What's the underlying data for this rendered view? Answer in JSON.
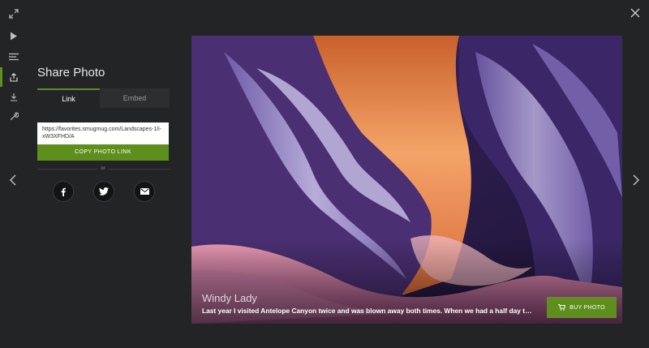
{
  "colors": {
    "accent": "#5e8f1c",
    "background": "#232425"
  },
  "toolbar": {
    "items": [
      {
        "name": "fullscreen",
        "icon": "expand-icon"
      },
      {
        "name": "slideshow",
        "icon": "play-icon"
      },
      {
        "name": "details",
        "icon": "menu-icon"
      },
      {
        "name": "share",
        "icon": "share-icon",
        "active": true
      },
      {
        "name": "download",
        "icon": "download-icon"
      },
      {
        "name": "tools",
        "icon": "wrench-icon"
      }
    ]
  },
  "share": {
    "title": "Share Photo",
    "tabs": [
      {
        "label": "Link",
        "active": true
      },
      {
        "label": "Embed",
        "active": false
      }
    ],
    "link_url": "https://favorites.smugmug.com/Landscapes-1/i-xW3XFHD/A",
    "copy_label": "COPY PHOTO LINK",
    "or_label": "or",
    "social": [
      "facebook-icon",
      "twitter-icon",
      "email-icon"
    ]
  },
  "photo": {
    "title": "Windy Lady",
    "caption": "Last year I visited Antelope Canyon twice and was blown away both times. When we had a half day to spare before heading home, we went back for one more tour.",
    "buy_label": "BUY PHOTO"
  },
  "navigation": {
    "prev_icon": "chevron-left-icon",
    "next_icon": "chevron-right-icon",
    "close_icon": "close-icon"
  }
}
